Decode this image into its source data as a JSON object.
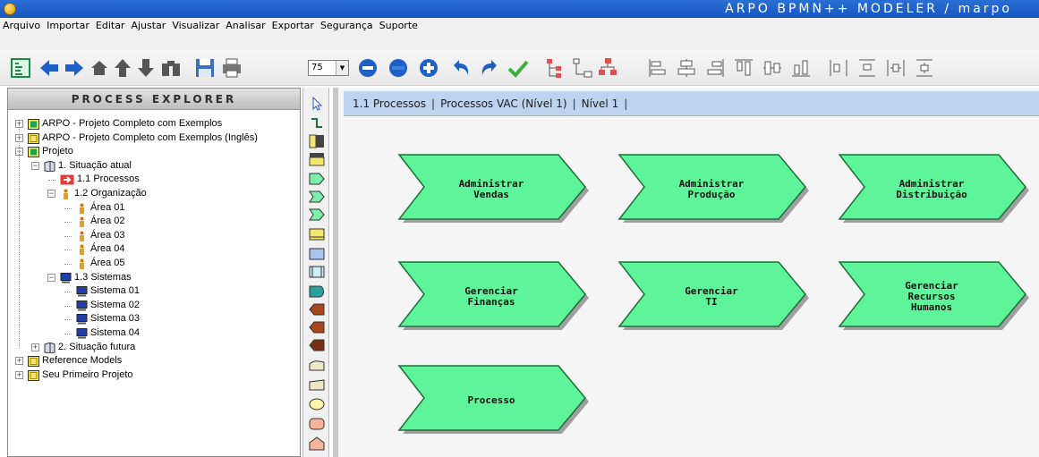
{
  "window": {
    "title": "ARPO BPMN++ MODELER / marpo",
    "app_icon": "app-globe-icon"
  },
  "menu": [
    "Arquivo",
    "Importar",
    "Editar",
    "Ajustar",
    "Visualizar",
    "Analisar",
    "Exportar",
    "Segurança",
    "Suporte"
  ],
  "toolbar": {
    "zoom_value": "75",
    "icons": [
      "explorer-toggle-icon",
      "arrow-left-icon",
      "arrow-right-icon",
      "home-icon",
      "arrow-up-icon",
      "arrow-down-icon",
      "binoculars-icon",
      "save-icon",
      "print-icon",
      "zoom-out-icon",
      "zoom-fit-icon",
      "zoom-in-icon",
      "undo-icon",
      "redo-icon",
      "check-icon",
      "tree-layout-icon",
      "hierarchy-icon",
      "org-chart-icon",
      "align-left-icon",
      "align-center-icon",
      "align-right-icon",
      "align-top-icon",
      "align-middle-icon",
      "align-bottom-icon",
      "distribute-horizontal-icon",
      "distribute-vertical-icon",
      "space-horizontal-icon",
      "space-vertical-icon"
    ]
  },
  "explorer": {
    "header": "PROCESS EXPLORER",
    "items": [
      {
        "label": "ARPO - Projeto Completo com Exemplos",
        "icon": "project-green-icon"
      },
      {
        "label": "ARPO - Projeto Completo com Exemplos (Inglês)",
        "icon": "project-yellow-icon"
      },
      {
        "label": "Projeto",
        "icon": "project-green-icon"
      },
      {
        "label": "1. Situação atual",
        "icon": "book-icon"
      },
      {
        "label": "1.1 Processos",
        "icon": "process-red-icon"
      },
      {
        "label": "1.2 Organização",
        "icon": "person-icon"
      },
      {
        "label": "Área 01",
        "icon": "person-icon"
      },
      {
        "label": "Área 02",
        "icon": "person-icon"
      },
      {
        "label": "Área 03",
        "icon": "person-icon"
      },
      {
        "label": "Área 04",
        "icon": "person-icon"
      },
      {
        "label": "Área 05",
        "icon": "person-icon"
      },
      {
        "label": "1.3 Sistemas",
        "icon": "computer-icon"
      },
      {
        "label": "Sistema 01",
        "icon": "computer-icon"
      },
      {
        "label": "Sistema 02",
        "icon": "computer-icon"
      },
      {
        "label": "Sistema 03",
        "icon": "computer-icon"
      },
      {
        "label": "Sistema 04",
        "icon": "computer-icon"
      },
      {
        "label": "2. Situação futura",
        "icon": "book-icon"
      },
      {
        "label": "Reference Models",
        "icon": "project-yellow-icon"
      },
      {
        "label": "Seu Primeiro Projeto",
        "icon": "project-yellow-icon"
      }
    ]
  },
  "palette": [
    "pointer-tool-icon",
    "connector-tool-icon",
    "lane-vertical-icon",
    "lane-horizontal-icon",
    "process-arrow-icon",
    "process-chevron-icon",
    "process-chevron-alt-icon",
    "note-icon",
    "rectangle-icon",
    "sub-process-icon",
    "display-icon",
    "card-left-icon",
    "card-left-alt-icon",
    "card-left-dark-icon",
    "manual-input-icon",
    "manual-input-alt-icon",
    "ellipse-icon",
    "rounded-rect-icon",
    "pentagon-icon"
  ],
  "breadcrumb": {
    "parts": [
      "1.1 Processos",
      "Processos VAC (Nível 1)",
      "Nível 1"
    ],
    "separator": "|"
  },
  "processes": [
    {
      "label": "Administrar\nVendas"
    },
    {
      "label": "Administrar\nProdução"
    },
    {
      "label": "Administrar\nDistribuição"
    },
    {
      "label": "Gerenciar\nFinanças"
    },
    {
      "label": "Gerenciar\nTI"
    },
    {
      "label": "Gerenciar\nRecursos\nHumanos"
    },
    {
      "label": "Processo"
    }
  ],
  "colors": {
    "process_fill": "#5ef59a",
    "process_stroke": "#1e6e3a",
    "titlebar": "#1a5fc8",
    "breadcrumb_bg": "#bed3ee"
  }
}
